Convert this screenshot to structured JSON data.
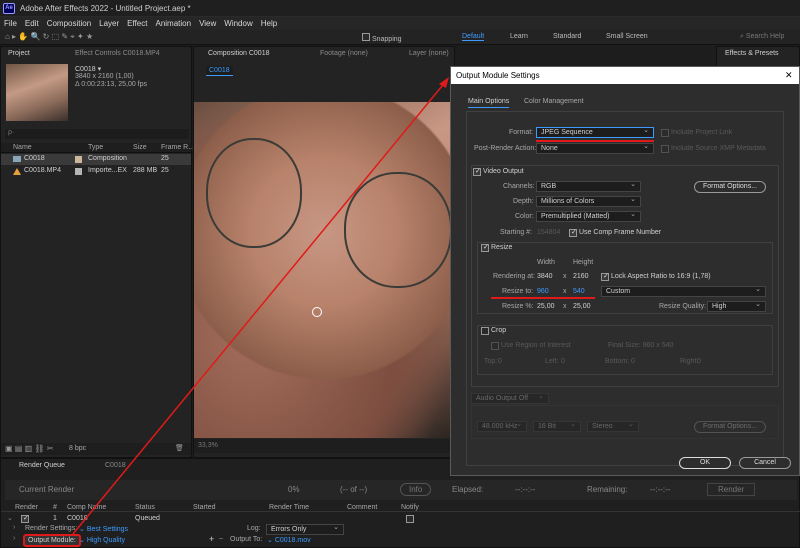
{
  "app": {
    "logo_text": "Ae",
    "title": "Adobe After Effects 2022 - Untitled Project.aep *"
  },
  "menu": [
    "File",
    "Edit",
    "Composition",
    "Layer",
    "Effect",
    "Animation",
    "View",
    "Window",
    "Help"
  ],
  "toolbar": {
    "snapping": "Snapping",
    "workspaces": [
      "Default",
      "Learn",
      "Standard",
      "Small Screen"
    ],
    "active_workspace": "Default",
    "search": "Search Help"
  },
  "project_panel": {
    "tab_project": "Project",
    "tab_effects": "Effect Controls C0018.MP4",
    "item_name": "C0018 ▾",
    "item_res": "3840 x 2160 (1,00)",
    "item_dur": "Δ 0:00:23:13, 25,00 fps",
    "search_placeholder": "ρ·",
    "headers": [
      "Name",
      "Type",
      "Size",
      "Frame R..."
    ],
    "rows": [
      {
        "name": "C0018",
        "type": "Composition",
        "size": "",
        "fps": "25"
      },
      {
        "name": "C0018.MP4",
        "type": "Importe...EX",
        "size": "288 MB",
        "fps": "25"
      }
    ],
    "bpc": "8 bpc"
  },
  "comp_panel": {
    "tab_comp": "Composition C0018",
    "tab_footage": "Footage (none)",
    "tab_layer": "Layer (none)",
    "comp_chip": "C0018",
    "zoom": "33,3%"
  },
  "effects_presets": {
    "tab": "Effects & Presets"
  },
  "render_queue": {
    "tab": "Render Queue",
    "tab2": "C0018",
    "current_render": "Current Render",
    "percent": "0%",
    "of": "(-- of --)",
    "info": "Info",
    "elapsed_label": "Elapsed:",
    "elapsed": "--:--:--",
    "remaining_label": "Remaining:",
    "remaining": "--:--:--",
    "render_btn": "Render",
    "headers": [
      "Render",
      "#",
      "Comp Name",
      "Status",
      "Started",
      "Render Time",
      "Comment",
      "Notify"
    ],
    "row": {
      "num": "1",
      "comp": "C0018",
      "status": "Queued"
    },
    "render_settings_label": "Render Settings:",
    "render_settings_value": "Best Settings",
    "log_label": "Log:",
    "log_value": "Errors Only",
    "output_module_label": "Output Module:",
    "output_module_value": "High Quality",
    "output_to_label": "Output To:",
    "output_to_value": "C0018.mov"
  },
  "dialog": {
    "title": "Output Module Settings",
    "close": "✕",
    "tabs": [
      "Main Options",
      "Color Management"
    ],
    "format_label": "Format:",
    "format_value": "JPEG Sequence",
    "include_project_link": "Include Project Link",
    "post_render_label": "Post-Render Action:",
    "post_render_value": "None",
    "include_xmp": "Include Source XMP Metadata",
    "video_output": "Video Output",
    "channels_label": "Channels:",
    "channels_value": "RGB",
    "depth_label": "Depth:",
    "depth_value": "Millions of Colors",
    "color_label": "Color:",
    "color_value": "Premultiplied (Matted)",
    "format_options": "Format Options...",
    "starting_label": "Starting #:",
    "starting_value": "154804",
    "use_comp_frame": "Use Comp Frame Number",
    "resize": "Resize",
    "width_label": "Width",
    "height_label": "Height",
    "rendering_at_label": "Rendering at:",
    "rendering_w": "3840",
    "rendering_h": "2160",
    "lock_aspect": "Lock Aspect Ratio to 16:9 (1,78)",
    "resize_to_label": "Resize to:",
    "resize_w": "960",
    "resize_h": "540",
    "resize_preset": "Custom",
    "resize_pct_label": "Resize %:",
    "resize_pct_w": "25,00",
    "resize_pct_h": "25,00",
    "resize_quality_label": "Resize Quality:",
    "resize_quality_value": "High",
    "x": "x",
    "crop": "Crop",
    "use_roi": "Use Region of Interest",
    "final_size": "Final Size: 960 x 540",
    "top": "Top:",
    "top_v": "0",
    "left": "Left:",
    "left_v": "0",
    "bottom": "Bottom:",
    "bottom_v": "0",
    "right": "Right:",
    "right_v": "0",
    "audio_output": "Audio Output Off",
    "audio_rate": "48.000 kHz",
    "audio_bits": "16 Bit",
    "audio_ch": "Stereo",
    "audio_format_options": "Format Options...",
    "ok": "OK",
    "cancel": "Cancel"
  },
  "colors": {
    "accent": "#3d9bff",
    "annotation": "#e01a1a",
    "dialog_bg": "#2d2d2d",
    "panel_bg": "#232323"
  }
}
